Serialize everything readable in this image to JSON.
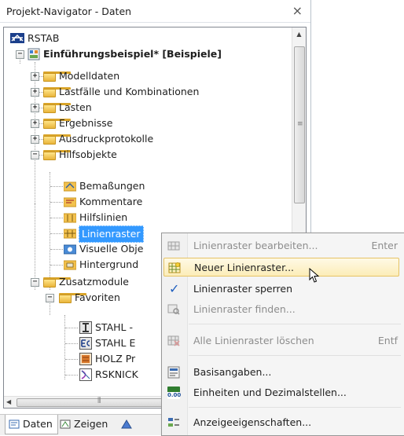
{
  "panel": {
    "title": "Projekt-Navigator - Daten",
    "close_glyph": "×"
  },
  "tree": {
    "root": "RSTAB",
    "project": "Einführungsbeispiel* [Beispiele]",
    "modelldaten": "Modelldaten",
    "lastfaelle": "Lastfälle und Kombinationen",
    "lasten": "Lasten",
    "ergebnisse": "Ergebnisse",
    "ausdruck": "Ausdruckprotokolle",
    "hilfsobjekte": "Hilfsobjekte",
    "bemassungen": "Bemaßungen",
    "kommentare": "Kommentare",
    "hilfslinien": "Hilfslinien",
    "linienraster": "Linienraster",
    "visuelle": "Visuelle Obje",
    "hintergrund": "Hintergrund",
    "zusatzmodule": "Zusatzmodule",
    "favoriten": "Favoriten",
    "stahl1": "STAHL -",
    "stahl2": "STAHL E",
    "holz": "HOLZ Pr",
    "rsknick": "RSKNICK",
    "expand_glyph": "+",
    "collapse_glyph": "−"
  },
  "tabs": {
    "daten": "Daten",
    "zeigen": "Zeigen"
  },
  "context_menu": {
    "items": [
      {
        "label": "Linienraster bearbeiten...",
        "shortcut": "Enter",
        "icon": "edit-grid-icon",
        "state": "disabled"
      },
      {
        "label": "Neuer Linienraster...",
        "shortcut": "",
        "icon": "new-grid-icon",
        "state": "highlighted"
      },
      {
        "label": "Linienraster sperren",
        "shortcut": "",
        "icon": "checkmark-icon",
        "state": "checked"
      },
      {
        "label": "Linienraster finden...",
        "shortcut": "",
        "icon": "find-grid-icon",
        "state": "disabled"
      },
      {
        "label": "Alle Linienraster löschen",
        "shortcut": "Entf",
        "icon": "delete-grid-icon",
        "state": "disabled"
      },
      {
        "label": "Basisangaben...",
        "shortcut": "",
        "icon": "settings-icon",
        "state": "enabled"
      },
      {
        "label": "Einheiten und Dezimalstellen...",
        "shortcut": "",
        "icon": "units-icon",
        "state": "enabled"
      },
      {
        "label": "Anzeigeeigenschaften...",
        "shortcut": "",
        "icon": "display-properties-icon",
        "state": "enabled"
      }
    ],
    "units_icon_text": "0.00"
  },
  "colors": {
    "selection": "#3399ff",
    "menu_highlight": "#fcedb8",
    "folder": "#e9b53b"
  }
}
